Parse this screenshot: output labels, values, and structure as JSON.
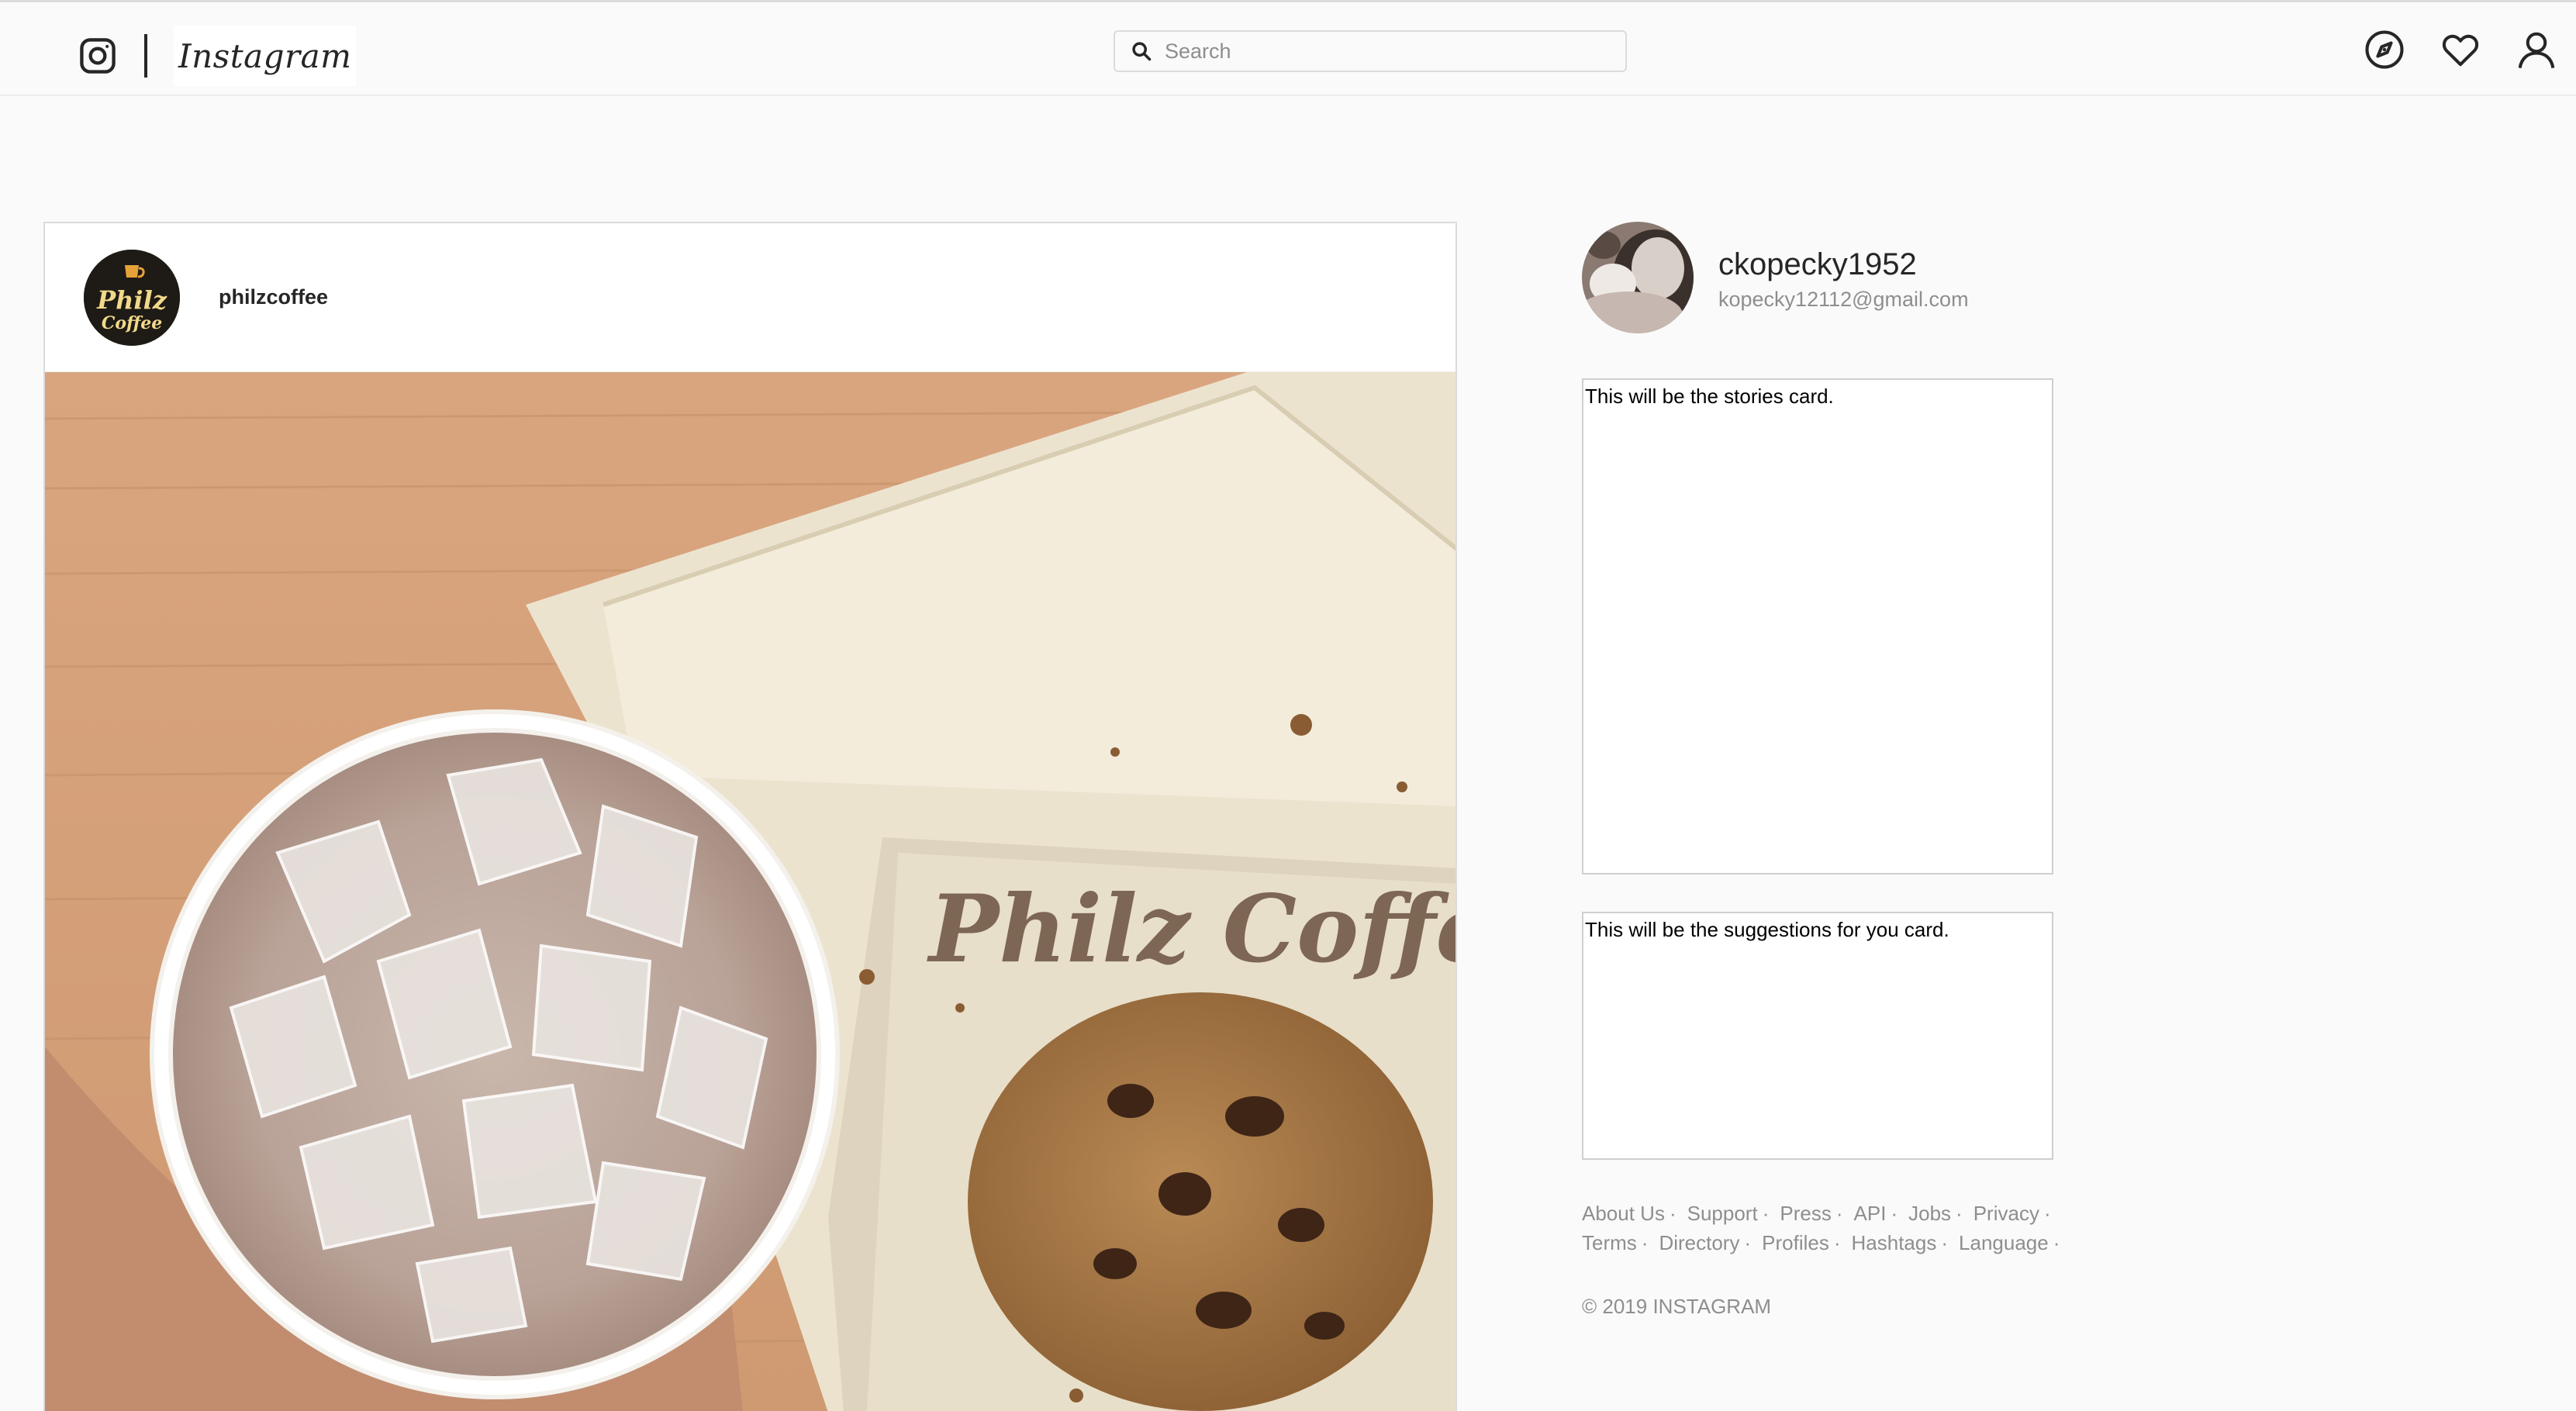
{
  "header": {
    "logo_text": "Instagram",
    "search": {
      "placeholder": "Search",
      "value": ""
    },
    "icons": [
      "camera-icon",
      "explore-icon",
      "heart-icon",
      "profile-icon"
    ]
  },
  "post": {
    "username": "philzcoffee",
    "avatar_text": "Philz Coffee"
  },
  "sidebar": {
    "username": "ckopecky1952",
    "email": "kopecky12112@gmail.com",
    "stories_card_text": "This will be the stories card.",
    "suggestions_card_text": "This will be the suggestions for you card.",
    "footer_row1": [
      "About Us",
      "Support",
      "Press",
      "API",
      "Jobs",
      "Privacy"
    ],
    "footer_row2": [
      "Terms",
      "Directory",
      "Profiles",
      "Hashtags",
      "Language"
    ],
    "copyright": "© 2019 INSTAGRAM"
  },
  "colors": {
    "background": "#fafafa",
    "border": "#dbdbdb",
    "text": "#262626",
    "muted": "#8e8e8e"
  }
}
